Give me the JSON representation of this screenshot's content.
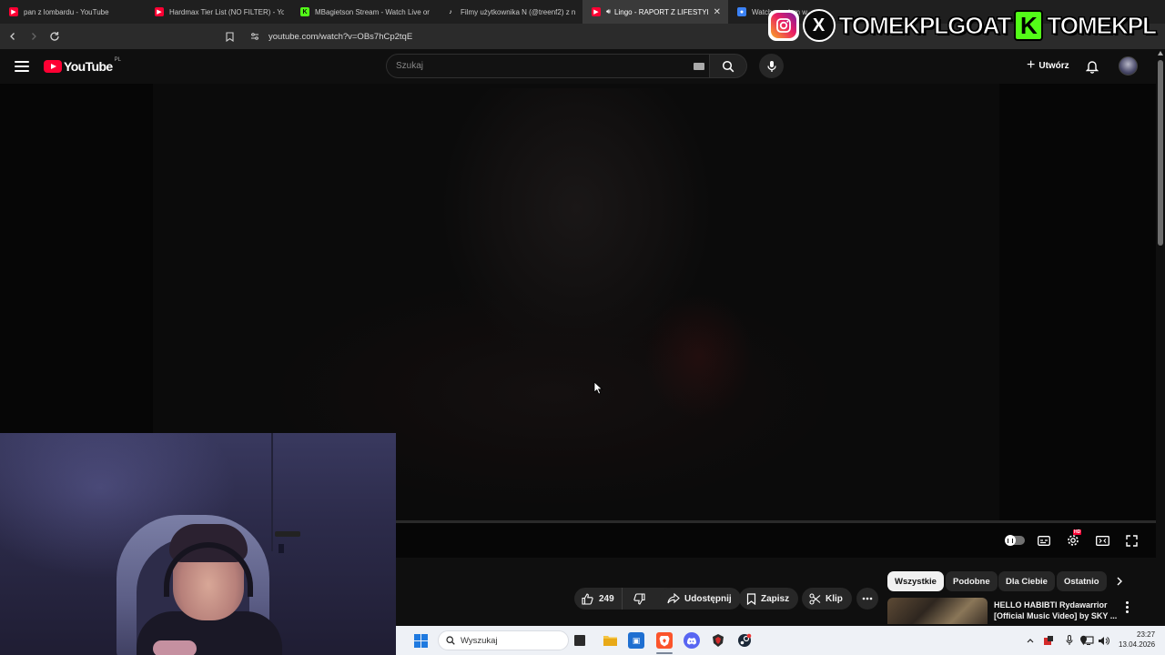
{
  "browser": {
    "tabs": [
      {
        "title": "pan z lombardu - YouTube",
        "favicon": "youtube-icon",
        "active": false
      },
      {
        "title": "Hardmax Tier List (NO FILTER) - You",
        "favicon": "youtube-icon",
        "active": false
      },
      {
        "title": "MBagietson Stream - Watch Live or",
        "favicon": "kick-icon",
        "active": false
      },
      {
        "title": "Filmy użytkownika N (@treenf2) z n",
        "favicon": "tiktok-icon",
        "active": false
      },
      {
        "title": "Lingo - RAPORT Z LIFESTYLE",
        "favicon": "youtube-icon",
        "active": true
      },
      {
        "title": "Watch przełom w",
        "favicon": "watch-icon",
        "active": false
      }
    ],
    "url": "youtube.com/watch?v=OBs7hCp2tqE"
  },
  "overlay": {
    "handle_1": "TOMEKPLGOAT",
    "handle_2": "TOMEKPL",
    "kick_letter": "K",
    "x_letter": "X"
  },
  "youtube": {
    "logo_text": "YouTube",
    "country_code": "PL",
    "search_placeholder": "Szukaj",
    "create_label": "Utwórz",
    "actions": {
      "like_count": "249",
      "share_label": "Udostępnij",
      "save_label": "Zapisz",
      "clip_label": "Klip"
    },
    "chips": [
      "Wszystkie",
      "Podobne",
      "Dla Ciebie",
      "Ostatnio"
    ],
    "active_chip": "Wszystkie",
    "recommended": {
      "title_line_1": "HELLO HABIBTI Rydawarrior",
      "title_line_2": "[Official Music Video] by SKY ..."
    }
  },
  "taskbar": {
    "search_placeholder": "Wyszukaj",
    "time": "23:27",
    "date": "13.04.2026"
  },
  "colors": {
    "youtube_red": "#ff0033",
    "kick_green": "#53fc18",
    "background": "#0f0f0f",
    "taskbar": "#eef1f6"
  }
}
